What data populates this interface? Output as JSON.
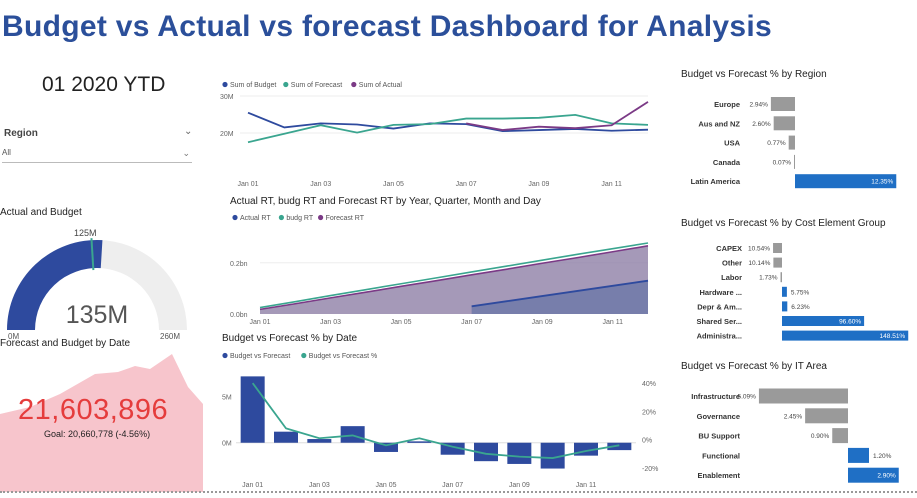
{
  "title": "Budget vs Actual vs forecast Dashboard for Analysis",
  "ytd_label": "01 2020 YTD",
  "region_filter": {
    "label": "Region",
    "value": "All"
  },
  "gauge_card": {
    "title": "Actual and Budget",
    "value_label": "135M",
    "target_label": "125M",
    "min_label": "0M",
    "max_label": "260M",
    "value": 135,
    "target": 125,
    "max": 260
  },
  "kpi_card": {
    "title": "Forecast and Budget by Date",
    "value": "21,603,896",
    "goal_text": "Goal: 20,660,778 (-4.56%)"
  },
  "colors": {
    "budget": "#2e4a9e",
    "forecast": "#3aa58f",
    "actual": "#7b3a86",
    "bar": "#2e4a9e",
    "hbar_neg": "#9a9a9a",
    "hbar_pos": "#1f6fc5",
    "title": "#2b4f9a",
    "kpi": "#e53c3c"
  },
  "chart_data": [
    {
      "type": "line",
      "title": "",
      "legend": [
        "Sum of Budget",
        "Sum of Forecast",
        "Sum of Actual"
      ],
      "x_labels": [
        "Jan 01",
        "Jan 03",
        "Jan 05",
        "Jan 07",
        "Jan 09",
        "Jan 11"
      ],
      "y_ticks": [
        "30M",
        "20M"
      ],
      "ylim": [
        10,
        30
      ],
      "series": [
        {
          "name": "Sum of Budget",
          "values": [
            25.5,
            21.5,
            22.6,
            22.3,
            21.2,
            22.6,
            22.4,
            20.5,
            20.8,
            21.1,
            20.6,
            20.9
          ]
        },
        {
          "name": "Sum of Forecast",
          "values": [
            17.5,
            19.8,
            22.1,
            20.1,
            22.2,
            22.4,
            23.9,
            23.9,
            24.1,
            24.9,
            22.6,
            22.2
          ]
        },
        {
          "name": "Sum of Actual",
          "values": [
            null,
            null,
            null,
            null,
            null,
            null,
            22.6,
            20.8,
            21.7,
            21.3,
            22.1,
            28.4
          ]
        }
      ]
    },
    {
      "type": "area",
      "title": "Actual RT, budg RT and Forecast RT by Year, Quarter, Month and Day",
      "legend": [
        "Actual RT",
        "budg RT",
        "Forecast RT"
      ],
      "x_labels": [
        "Jan 01",
        "Jan 03",
        "Jan 05",
        "Jan 07",
        "Jan 09",
        "Jan 11"
      ],
      "y_ticks": [
        "0.2bn",
        "0.0bn"
      ],
      "ylim": [
        0,
        0.32
      ],
      "series": [
        {
          "name": "Actual RT",
          "values": [
            null,
            null,
            null,
            null,
            null,
            null,
            0.03,
            0.05,
            0.07,
            0.09,
            0.11,
            0.13
          ]
        },
        {
          "name": "budg RT",
          "values": [
            0.025,
            0.048,
            0.072,
            0.095,
            0.118,
            0.141,
            0.164,
            0.187,
            0.21,
            0.233,
            0.255,
            0.277
          ]
        },
        {
          "name": "Forecast RT",
          "values": [
            0.018,
            0.04,
            0.063,
            0.085,
            0.108,
            0.13,
            0.153,
            0.175,
            0.198,
            0.22,
            0.243,
            0.266
          ]
        }
      ]
    },
    {
      "type": "bar",
      "title": "Budget vs Forecast % by Date",
      "legend": [
        "Budget vs Forecast",
        "Budget vs Forecast %"
      ],
      "x_labels": [
        "Jan 01",
        "Jan 03",
        "Jan 05",
        "Jan 07",
        "Jan 09",
        "Jan 11"
      ],
      "y_ticks_left": [
        "5M",
        "0M"
      ],
      "y_ticks_right": [
        "40%",
        "20%",
        "0%",
        "-20%"
      ],
      "ylim_left": [
        -3.5,
        8
      ],
      "ylim_right": [
        -25,
        50
      ],
      "bar_values": [
        7.2,
        1.2,
        0.4,
        1.8,
        -1.0,
        0.15,
        -1.3,
        -2.0,
        -2.3,
        -2.8,
        -1.4,
        -0.8
      ],
      "line_values": [
        40,
        8,
        1,
        3,
        -4,
        1,
        -5,
        -10,
        -12,
        -13,
        -8,
        -4
      ]
    },
    {
      "type": "hbar",
      "title": "Budget vs Forecast % by Region",
      "categories": [
        "Europe",
        "Aus and NZ",
        "USA",
        "Canada",
        "Latin America"
      ],
      "values": [
        -2.94,
        -2.6,
        -0.77,
        -0.07,
        12.35
      ],
      "labels": [
        "2.94%",
        "2.60%",
        "0.77%",
        "0.07%",
        "12.35%"
      ]
    },
    {
      "type": "hbar",
      "title": "Budget vs Forecast % by Cost Element Group",
      "categories": [
        "CAPEX",
        "Other",
        "Labor",
        "Hardware ...",
        "Depr & Am...",
        "Shared Ser...",
        "Administra..."
      ],
      "values": [
        -10.54,
        -10.14,
        -1.73,
        5.75,
        6.23,
        96.6,
        148.51
      ],
      "labels": [
        "10.54%",
        "10.14%",
        "1.73%",
        "5.75%",
        "6.23%",
        "96.60%",
        "148.51%"
      ]
    },
    {
      "type": "hbar",
      "title": "Budget vs Forecast % by IT Area",
      "categories": [
        "Infrastructure",
        "Governance",
        "BU Support",
        "Functional",
        "Enablement"
      ],
      "values": [
        -5.09,
        -2.45,
        -0.9,
        1.2,
        2.9
      ],
      "labels": [
        "5.09%",
        "2.45%",
        "0.90%",
        "1.20%",
        "2.90%"
      ]
    }
  ]
}
